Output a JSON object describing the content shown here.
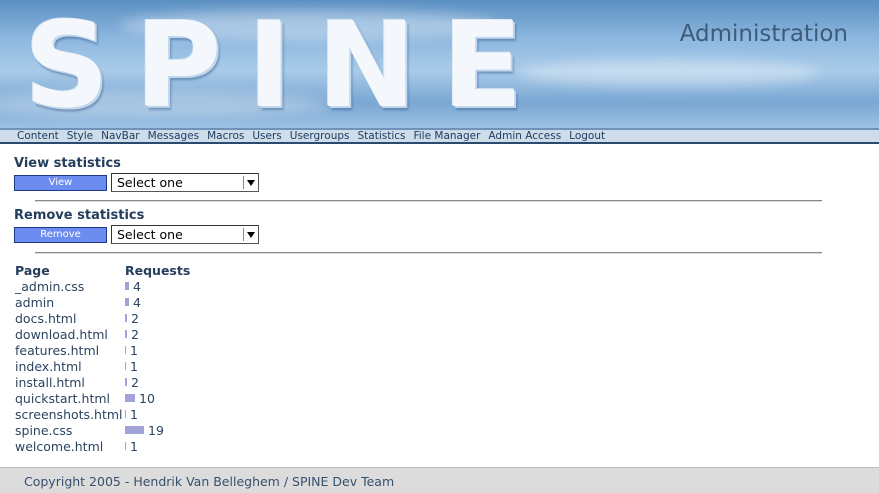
{
  "header": {
    "logo_text": "SPINE",
    "title": "Administration"
  },
  "nav": [
    {
      "label": "Content"
    },
    {
      "label": "Style"
    },
    {
      "label": "NavBar"
    },
    {
      "label": "Messages"
    },
    {
      "label": "Macros"
    },
    {
      "label": "Users"
    },
    {
      "label": "Usergroups"
    },
    {
      "label": "Statistics"
    },
    {
      "label": "File Manager"
    },
    {
      "label": "Admin Access"
    },
    {
      "label": "Logout"
    }
  ],
  "view": {
    "title": "View statistics",
    "button": "View",
    "select": "Select one"
  },
  "remove": {
    "title": "Remove statistics",
    "button": "Remove",
    "select": "Select one"
  },
  "table": {
    "col_page": "Page",
    "col_requests": "Requests",
    "rows": [
      {
        "page": "_admin.css",
        "requests": 4
      },
      {
        "page": "admin",
        "requests": 4
      },
      {
        "page": "docs.html",
        "requests": 2
      },
      {
        "page": "download.html",
        "requests": 2
      },
      {
        "page": "features.html",
        "requests": 1
      },
      {
        "page": "index.html",
        "requests": 1
      },
      {
        "page": "install.html",
        "requests": 2
      },
      {
        "page": "quickstart.html",
        "requests": 10
      },
      {
        "page": "screenshots.html",
        "requests": 1
      },
      {
        "page": "spine.css",
        "requests": 19
      },
      {
        "page": "welcome.html",
        "requests": 1
      }
    ]
  },
  "footer": {
    "text": "Copyright 2005 - Hendrik Van Belleghem / SPINE Dev Team"
  },
  "colors": {
    "button": "#6c8cf0",
    "bar": "#a3a3d9",
    "navbar": "#cfdcea"
  }
}
